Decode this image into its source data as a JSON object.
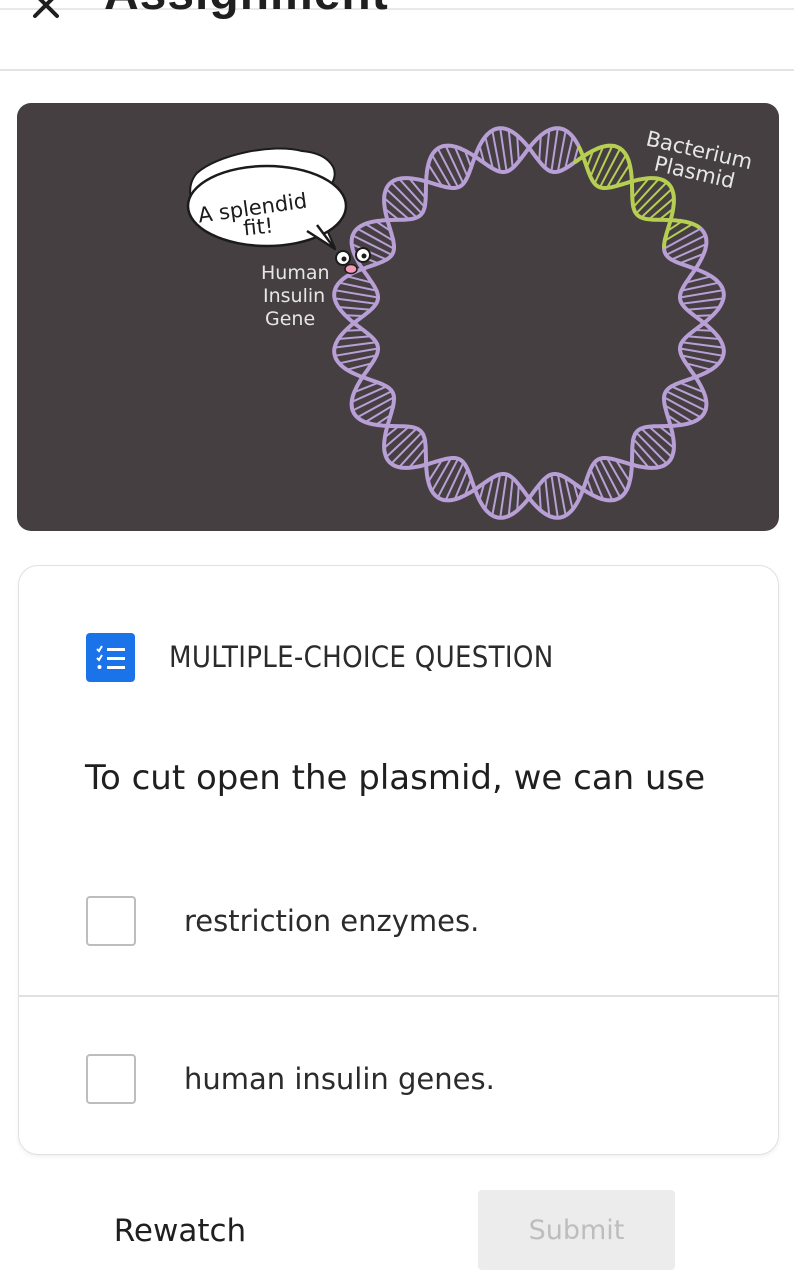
{
  "header": {
    "title": "Assignment",
    "close_icon": "close-icon"
  },
  "illustration": {
    "speech_bubble": {
      "line1": "A splendid",
      "line2": "fit!"
    },
    "gene_label": {
      "line1": "Human",
      "line2": "Insulin",
      "line3": "Gene"
    },
    "plasmid_label": {
      "line1": "Bacterium",
      "line2": "Plasmid"
    },
    "colors": {
      "background": "#453f41",
      "plasmid": "#b89fd6",
      "gene": "#b6cf52"
    }
  },
  "question": {
    "type_label": "MULTIPLE-CHOICE QUESTION",
    "type_icon": "checklist-icon",
    "text": "To cut open the plasmid, we can use",
    "options": [
      {
        "label": "restriction enzymes.",
        "checked": false
      },
      {
        "label": "human insulin genes.",
        "checked": false
      }
    ]
  },
  "actions": {
    "rewatch_label": "Rewatch",
    "submit_label": "Submit",
    "submit_enabled": false
  },
  "colors": {
    "accent": "#1a73e8"
  }
}
